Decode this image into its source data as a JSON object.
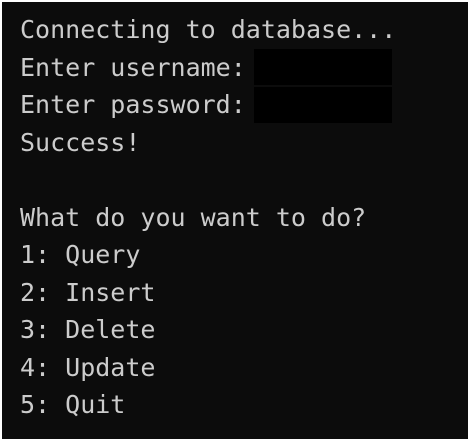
{
  "terminal": {
    "status_line": "Connecting to database...",
    "username_prompt": "Enter username:",
    "password_prompt": "Enter password:",
    "result_line": "Success!",
    "menu_heading": "What do you want to do?",
    "menu_options": [
      "1: Query",
      "2: Insert",
      "3: Delete",
      "4: Update",
      "5: Quit"
    ]
  },
  "colors": {
    "background": "#0c0c0c",
    "text": "#cccccc",
    "redaction": "#000000"
  }
}
